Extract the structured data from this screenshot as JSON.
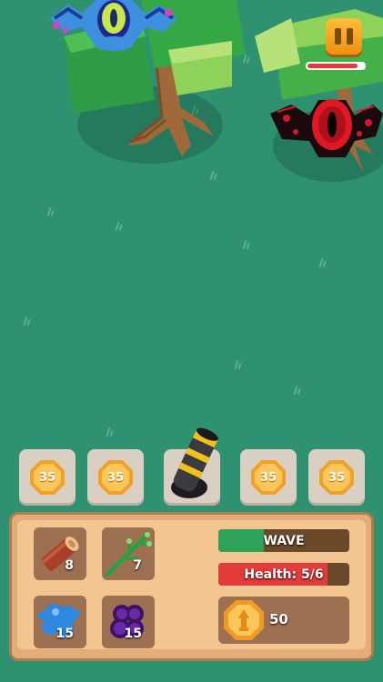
{
  "pause": {
    "icon": "pause-icon"
  },
  "enemy": {
    "health_fraction": 0.9,
    "health_color": "#e23b3b"
  },
  "tower_slots": [
    {
      "cost": "35",
      "icon": "coin-icon"
    },
    {
      "cost": "35",
      "icon": "coin-icon"
    },
    {
      "occupied_by": "cannon-tower"
    },
    {
      "cost": "35",
      "icon": "coin-icon"
    },
    {
      "cost": "35",
      "icon": "coin-icon"
    }
  ],
  "resources": {
    "wood": {
      "count": "8",
      "icon": "log-icon"
    },
    "branch": {
      "count": "7",
      "icon": "branch-icon"
    },
    "blue_ore": {
      "count": "15",
      "icon": "blue-blob-icon"
    },
    "purple_ore": {
      "count": "15",
      "icon": "purple-blob-icon"
    }
  },
  "wave": {
    "label": "WAVE",
    "progress": 0.35,
    "color": "#2fa25a"
  },
  "health": {
    "label": "Health: 5/6",
    "fraction": 0.8333,
    "color": "#e23b3b"
  },
  "coins": {
    "amount": "50",
    "icon": "tower-coin-icon"
  }
}
